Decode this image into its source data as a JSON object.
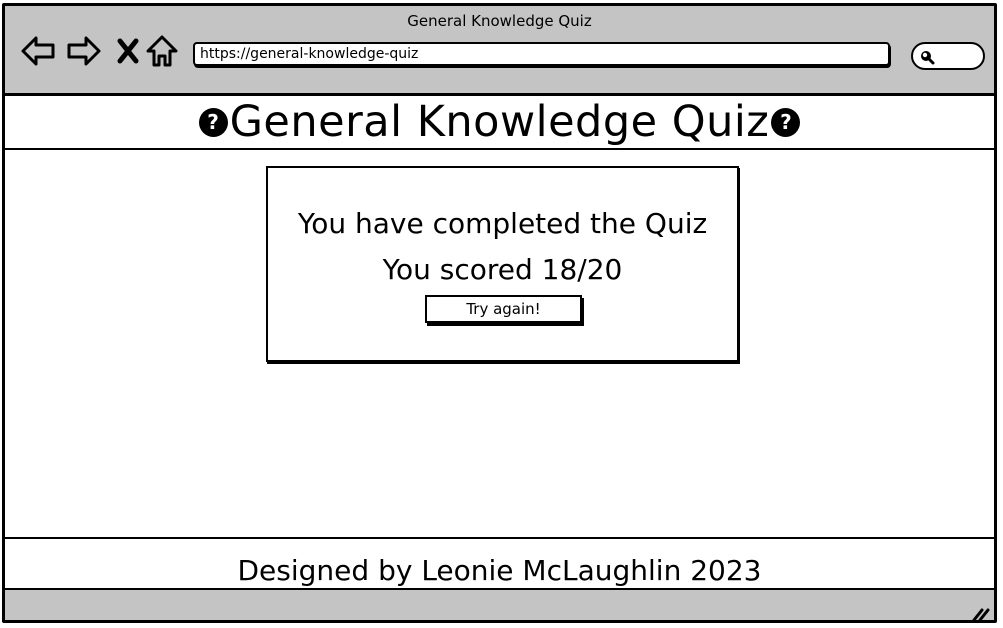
{
  "window": {
    "title": "General Knowledge Quiz"
  },
  "toolbar": {
    "back_icon": "back-arrow-icon",
    "forward_icon": "forward-arrow-icon",
    "stop_icon": "close-icon",
    "home_icon": "home-icon",
    "url": "https://general-knowledge-quiz",
    "search_icon": "search-icon"
  },
  "header": {
    "title": "General Knowledge Quiz",
    "left_icon": "question-circle-icon",
    "right_icon": "question-circle-icon",
    "left_icon_glyph": "?",
    "right_icon_glyph": "?"
  },
  "result": {
    "completed_text": "You have completed the Quiz",
    "score_text": "You scored 18/20",
    "try_again_label": "Try again!"
  },
  "footer": {
    "text": "Designed by Leonie McLaughlin 2023"
  },
  "colors": {
    "chrome_bg": "#c4c4c4",
    "ink": "#000000",
    "page_bg": "#ffffff"
  }
}
